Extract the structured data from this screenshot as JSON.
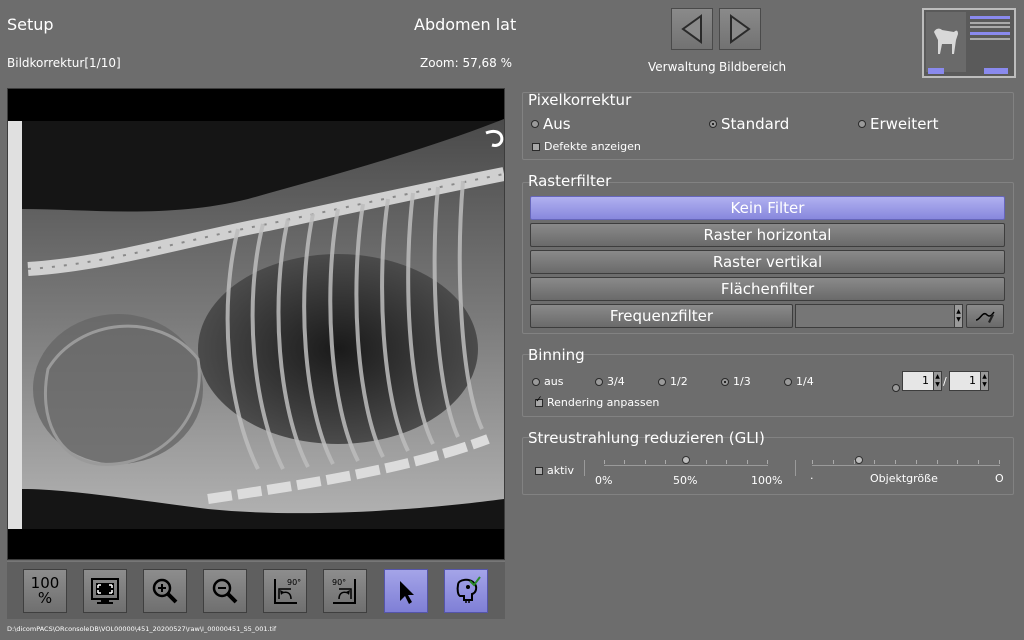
{
  "header": {
    "title": "Setup",
    "exam": "Abdomen lat",
    "step": "Bildkorrektur[1/10]",
    "zoom": "Zoom: 57,68 %",
    "nav_labels": [
      "Verwaltung",
      "Bildbereich"
    ]
  },
  "toolbar": {
    "zoom100_line1": "100",
    "zoom100_line2": "%",
    "rot_left_label": "90°",
    "rot_right_label": "90°"
  },
  "pixelkorrektur": {
    "title": "Pixelkorrektur",
    "options": [
      {
        "label": "Aus",
        "selected": false
      },
      {
        "label": "Standard",
        "selected": true
      },
      {
        "label": "Erweitert",
        "selected": false
      }
    ],
    "defects_label": "Defekte anzeigen",
    "defects_checked": false
  },
  "rasterfilter": {
    "title": "Rasterfilter",
    "buttons": [
      "Kein Filter",
      "Raster horizontal",
      "Raster vertikal",
      "Flächenfilter",
      "Frequenzfilter"
    ],
    "selected": "Kein Filter"
  },
  "binning": {
    "title": "Binning",
    "options": [
      {
        "label": "aus",
        "selected": false
      },
      {
        "label": "3/4",
        "selected": false
      },
      {
        "label": "1/2",
        "selected": false
      },
      {
        "label": "1/3",
        "selected": true
      },
      {
        "label": "1/4",
        "selected": false
      }
    ],
    "custom_numerator": "1",
    "custom_denominator": "1",
    "fraction_sep": "/",
    "render_label": "Rendering anpassen",
    "render_checked": true
  },
  "gli": {
    "title": "Streustrahlung reduzieren (GLI)",
    "active_label": "aktiv",
    "active_checked": false,
    "scale_labels": [
      "0%",
      "50%",
      "100%"
    ],
    "strength_value": 50,
    "size_label": "Objektgröße",
    "size_min": "·",
    "size_max": "O"
  },
  "footer": {
    "file_path": "D:\\dicomPACS\\ORconsoleDB\\VOL00000\\451_20200527\\raw\\I_00000451_S5_001.tif"
  },
  "colors": {
    "background": "#6d6d6d",
    "accent": "#8888dd"
  }
}
